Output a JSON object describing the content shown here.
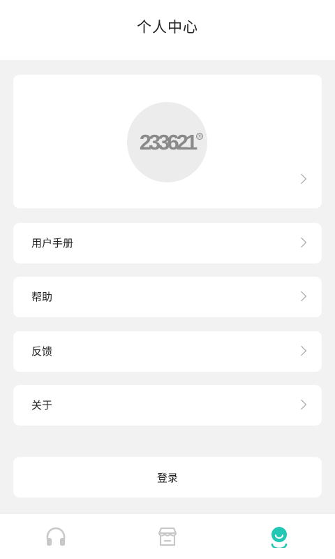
{
  "header": {
    "title": "个人中心"
  },
  "profile": {
    "avatar_logo_text": "233621",
    "avatar_logo_mark": "®"
  },
  "menu": {
    "items": [
      {
        "label": "用户手册"
      },
      {
        "label": "帮助"
      },
      {
        "label": "反馈"
      },
      {
        "label": "关于"
      }
    ]
  },
  "login": {
    "label": "登录"
  },
  "tabbar": {
    "tabs": [
      {
        "icon": "headphones-icon",
        "active": false
      },
      {
        "icon": "store-icon",
        "active": false
      },
      {
        "icon": "profile-face-icon",
        "active": true
      }
    ],
    "active_color": "#21c7b4",
    "inactive_color": "#c8c8c8"
  }
}
